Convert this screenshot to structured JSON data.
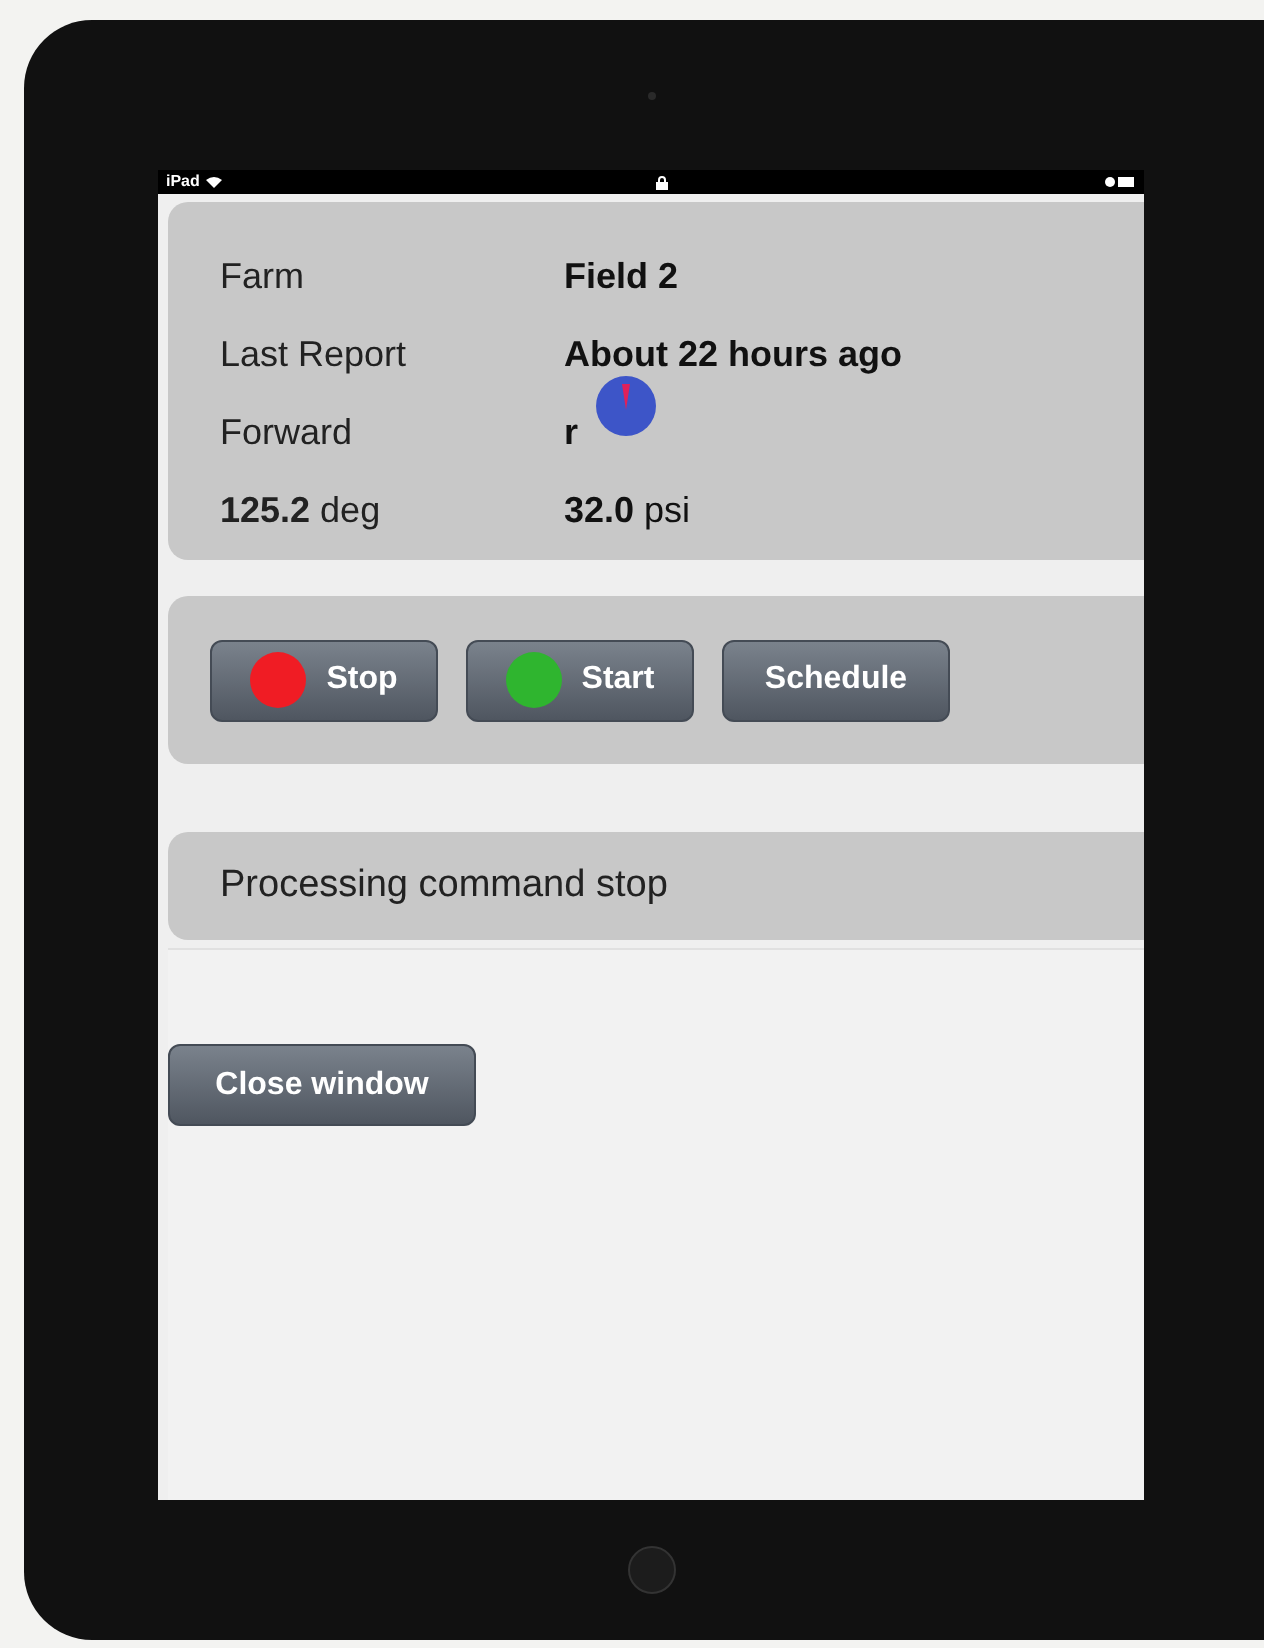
{
  "status_bar": {
    "carrier": "iPad"
  },
  "info": [
    {
      "label": "Farm",
      "value": "Field 2"
    },
    {
      "label": "Last Report",
      "value": "About 22 hours ago"
    },
    {
      "label": "Forward",
      "value": "r",
      "kind": "gauge"
    },
    {
      "label": "**125.2** deg",
      "value": "**32.0** psi",
      "kind": "reading"
    }
  ],
  "buttons": [
    {
      "label": "Stop",
      "color": "#f01c24"
    },
    {
      "label": "Start",
      "color": "#2fb52f"
    },
    {
      "label": "Schedule"
    }
  ],
  "message": "Processing command stop",
  "close_button": "Close window"
}
